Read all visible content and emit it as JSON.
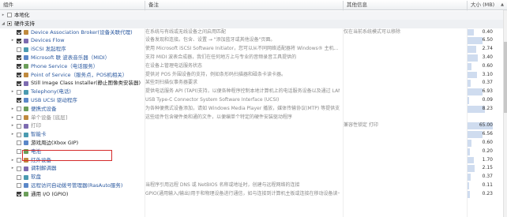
{
  "columns": {
    "component": "组件",
    "remark": "备注",
    "other_info": "其他信息",
    "size": "大小 (MB)"
  },
  "colors": {
    "highlight_border": "#d52b2b",
    "link": "#2c5aa0"
  },
  "rows": [
    {
      "name": "本地化",
      "desc": "",
      "other": "",
      "size": "",
      "level": 0,
      "check": "none",
      "expander": "▸",
      "style": "group"
    },
    {
      "name": "硬件支持",
      "desc": "",
      "other": "",
      "size": "",
      "level": 0,
      "check": "partial",
      "expander": "◢",
      "style": "group2"
    },
    {
      "name": "Device Association Broker(设备关联代理)",
      "desc": "在系统与有线或无线设备之间启用匹配",
      "other": "仅在当前系统模式可以移除",
      "size": "0.40",
      "level": 1,
      "check": "checked",
      "expander": "",
      "bar": 0.25
    },
    {
      "name": "Devices Flow",
      "desc": "设备发现和连接。包含、设置 → \"添加蓝牙或其他设备\"页面。",
      "other": "",
      "size": "6.50",
      "level": 1,
      "check": "checked",
      "expander": "▸",
      "bar": 0.6
    },
    {
      "name": "iSCSI 发起程序",
      "desc": "使用 Microsoft iSCSI Software Initiator，您可以从不同网络适配器将 Windows® 主机...",
      "other": "",
      "size": "2.74",
      "level": 1,
      "check": "none",
      "expander": "",
      "bar": 0.35
    },
    {
      "name": "Microsoft 联 波表音乐器（MIDI）",
      "desc": "支持 MIDI 波表合成器，我们在任何地方上与专业的音频录音工具提供的",
      "other": "",
      "size": "3.40",
      "level": 1,
      "check": "checked",
      "expander": "",
      "bar": 0.4
    },
    {
      "name": "Phone Service（电话服务）",
      "desc": "在设备上管理电话服务状态",
      "other": "",
      "size": "0.60",
      "level": 1,
      "check": "checked",
      "expander": "",
      "bar": 0.15
    },
    {
      "name": "Point of Service（服务点，POS机相关）",
      "desc": "提供对 POS 外围设备的支持，例如条形码扫描器和磁条卡读卡器。",
      "other": "",
      "size": "3.10",
      "level": 1,
      "check": "checked",
      "expander": "",
      "bar": 0.38
    },
    {
      "name": "Still Image Class Installer(静止图像类安装器)",
      "desc": "某些到扫描仪事务器要求",
      "other": "",
      "size": "0.37",
      "level": 1,
      "check": "checked",
      "expander": "",
      "bar": 0.12,
      "style": "dark"
    },
    {
      "name": "Telephony(电话)",
      "desc": "提供电话服务 API (TAPI)支持，以便各种程序控制本地计算机上的电话服务设备以及通过 LAN ...",
      "other": "",
      "size": "6.93",
      "level": 1,
      "check": "none",
      "expander": "▸",
      "bar": 0.6
    },
    {
      "name": "USB UCSI 驱动程序",
      "desc": "USB Type-C Connector System Software Interface (UCSI)",
      "other": "",
      "size": "0.09",
      "level": 1,
      "check": "checked",
      "expander": "",
      "bar": 0.05
    },
    {
      "name": "便携式设备",
      "desc": "为各种便携式设备添加，请如 Windows Media Player 播放，媒体传输协议(MTP) 等提供支持...",
      "other": "",
      "size": "8.23",
      "level": 1,
      "check": "none",
      "expander": "▸",
      "bar": 0.7
    },
    {
      "name": "单个设备 [底层]",
      "desc": "这些组件包含硬件类和通的文件，以便编单个特定的硬件安装驱动程序",
      "other": "",
      "size": "",
      "level": 1,
      "check": "none",
      "expander": "▸",
      "style": "grey"
    },
    {
      "name": "打印",
      "desc": "",
      "other": "兼容性锁定    打印",
      "size": "65.00",
      "level": 1,
      "check": "none",
      "expander": "▸",
      "style": "grey",
      "bar": 1.0
    },
    {
      "name": "智能卡",
      "desc": "",
      "other": "",
      "size": "6.56",
      "level": 1,
      "check": "none",
      "expander": "▸",
      "bar": 0.6
    },
    {
      "name": "游戏周边(Xbox GIP)",
      "desc": "",
      "other": "",
      "size": "0.60",
      "level": 1,
      "check": "none",
      "expander": "",
      "bar": 0.15,
      "style": "dark"
    },
    {
      "name": "电池",
      "desc": "",
      "other": "",
      "size": "0.20",
      "level": 1,
      "check": "none",
      "expander": "",
      "bar": 0.08
    },
    {
      "name": "红外设备",
      "desc": "",
      "other": "",
      "size": "1.70",
      "level": 1,
      "check": "none",
      "expander": "▸",
      "bar": 0.25
    },
    {
      "name": "调制解调器",
      "desc": "",
      "other": "",
      "size": "2.15",
      "level": 1,
      "check": "none",
      "expander": "▸",
      "bar": 0.28
    },
    {
      "name": "软盘",
      "desc": "",
      "other": "",
      "size": "0.37",
      "level": 1,
      "check": "none",
      "expander": "",
      "bar": 0.12
    },
    {
      "name": "远程访问自动拨号管理器(RasAuto服务)",
      "desc": "当程序引用远程 DNS 或 NetBIOS 名称或地址时，创建与远程网络的连接",
      "other": "",
      "size": "0.11",
      "level": 1,
      "check": "none",
      "expander": "",
      "bar": 0.06
    },
    {
      "name": "通用 I/O (GPIO)",
      "desc": "GPIO(通用输入/输出)用于和物理设备进行通信，如与连接到计算机主板或连接在移动设备读卡器的移动主机上的外围设备...",
      "other": "",
      "size": "0.23",
      "level": 1,
      "check": "checked",
      "expander": "",
      "bar": 0.08,
      "style": "dark"
    }
  ]
}
